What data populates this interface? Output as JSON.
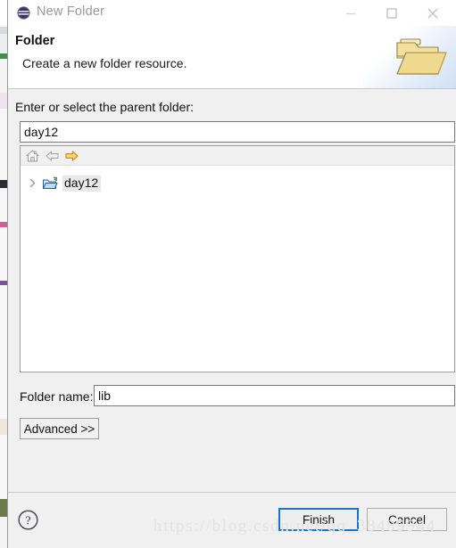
{
  "window": {
    "title": "New Folder",
    "icon": "eclipse-logo-icon",
    "controls": {
      "minimize": "minimize-icon",
      "maximize": "maximize-icon",
      "close": "close-icon"
    }
  },
  "header": {
    "title": "Folder",
    "description": "Create a new folder resource.",
    "banner_icon": "open-folder-icon"
  },
  "form": {
    "parent_label": "Enter or select the parent folder:",
    "parent_value": "day12",
    "parent_placeholder": "",
    "folder_name_label": "Folder name:",
    "folder_name_value": "lib",
    "folder_name_placeholder": "",
    "advanced_label": "Advanced >>"
  },
  "tree": {
    "toolbar": [
      {
        "name": "home-icon",
        "title": "Home"
      },
      {
        "name": "back-arrow-icon",
        "title": "Back"
      },
      {
        "name": "forward-arrow-icon",
        "title": "Forward"
      }
    ],
    "items": [
      {
        "label": "day12",
        "icon": "folder-icon",
        "expanded": false,
        "selected": true
      }
    ]
  },
  "footer": {
    "help_icon": "help-question-icon",
    "finish_label": "Finish",
    "cancel_label": "Cancel"
  },
  "watermark": "https://blog.csdn.net/qq_38409944",
  "colors": {
    "dialog_bg": "#f0f0f0",
    "header_bg": "#ffffff",
    "accent_focus": "#1a73c4",
    "title_text": "#9a9a9a",
    "forward_arrow": "#f0a830",
    "banner_blue": "#cfe0f3"
  }
}
